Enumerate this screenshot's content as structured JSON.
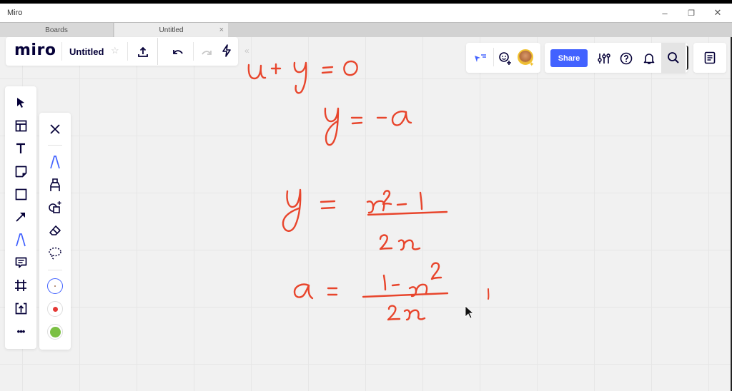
{
  "window": {
    "title": "Miro",
    "controls": {
      "minimize": "–",
      "restore": "❐",
      "close": "✕"
    }
  },
  "tabs": [
    {
      "label": "Boards",
      "active": false
    },
    {
      "label": "Untitled",
      "active": true,
      "close": "×"
    }
  ],
  "header": {
    "logo": "miro",
    "board_title": "Untitled",
    "star_icon": "☆",
    "icons": [
      "export-icon",
      "undo-icon",
      "redo-icon",
      "lightning-icon",
      "collapse-icon"
    ],
    "collapse_glyph": "«"
  },
  "collab": {
    "icons": [
      "cursor-follow-icon",
      "add-reaction-icon",
      "user-avatar"
    ]
  },
  "actions": {
    "share_label": "Share",
    "icons": [
      "settings-sliders-icon",
      "help-icon",
      "bell-icon",
      "search-icon"
    ]
  },
  "notes": {
    "icon": "notes-icon"
  },
  "toolbar": {
    "tools": [
      "select",
      "templates",
      "text",
      "sticky-note",
      "shape",
      "arrow",
      "pen",
      "comment",
      "frame",
      "upload",
      "more"
    ],
    "active": "pen",
    "more_glyph": "•••"
  },
  "pen_panel": {
    "tools": [
      "close",
      "pen",
      "marker",
      "shape-recognition",
      "eraser",
      "lasso"
    ],
    "active": "pen",
    "colors": [
      {
        "name": "blue-thin",
        "hex": "#4262ff",
        "selected": true
      },
      {
        "name": "red",
        "hex": "#e53935",
        "selected": false
      },
      {
        "name": "green",
        "hex": "#7bc043",
        "selected": false
      }
    ]
  },
  "colors": {
    "ink": "#e8452c",
    "accent": "#4262ff",
    "text": "#050038"
  },
  "canvas_content": {
    "equations": [
      "u + y = 0",
      "y = -a",
      "y = (x^2 - 1) / (2x)",
      "a = (1 - x^2) / (2x)"
    ]
  }
}
